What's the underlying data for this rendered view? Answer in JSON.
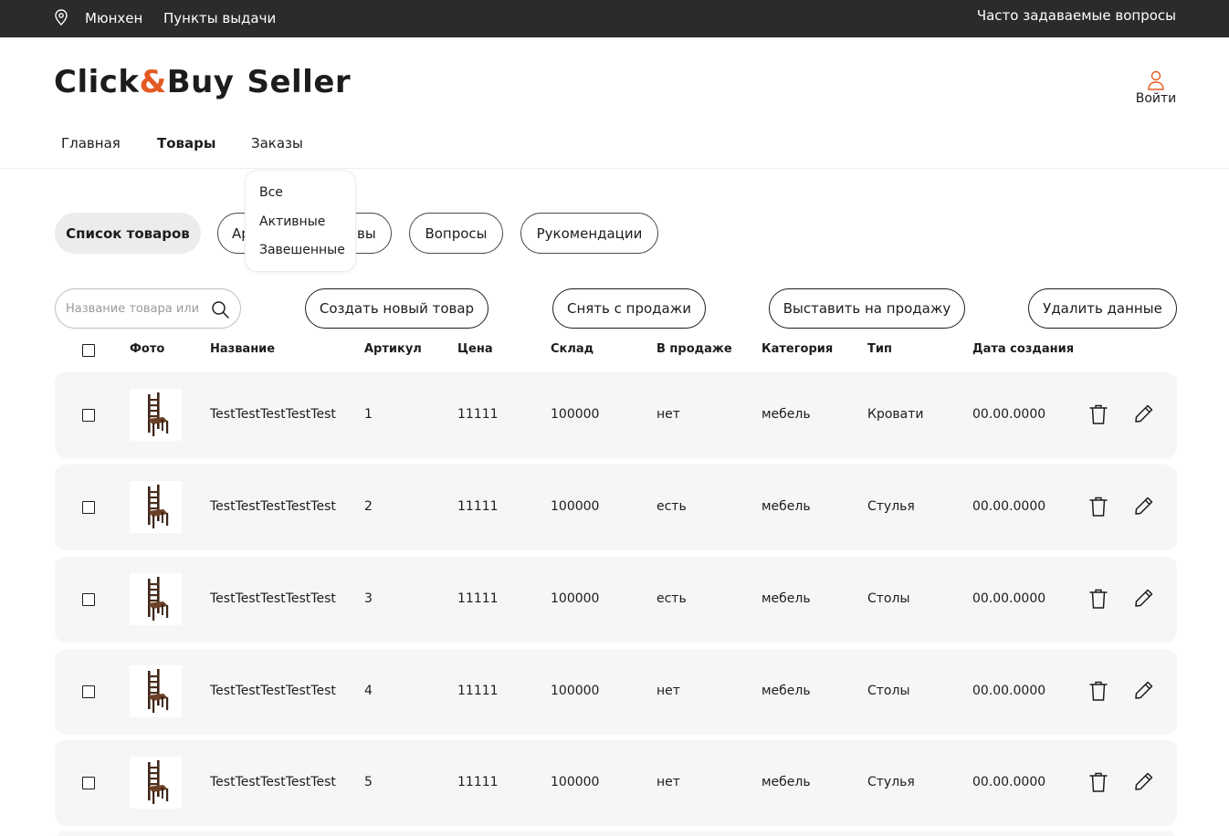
{
  "topbar": {
    "city": "Мюнхен",
    "pickup_points": "Пункты выдачи",
    "faq": "Часто задаваемые вопросы",
    "location_icon": "map-pin-icon"
  },
  "header": {
    "logo_left": "Click",
    "logo_amp": "&",
    "logo_right": "Buy",
    "logo_suffix": "Seller",
    "login_label": "Войти",
    "user_icon": "user-icon"
  },
  "colors": {
    "topbar_bg": "#2b2a2d",
    "accent": "#e35a22",
    "row_bg": "#f6f6f6",
    "active_tab_bg": "#ececec"
  },
  "nav": {
    "items": [
      {
        "label": "Главная"
      },
      {
        "label": "Товары",
        "active": true
      },
      {
        "label": "Заказы"
      }
    ]
  },
  "tabs": [
    {
      "label": "Список товаров",
      "active": true
    },
    {
      "label_visible_start": "Ар",
      "label_visible_end": "вы"
    },
    {
      "label": "Вопросы"
    },
    {
      "label": "Рукомендации"
    }
  ],
  "dropdown": {
    "items": [
      "Все",
      "Активные",
      "Завешенные"
    ]
  },
  "toolbar": {
    "search_placeholder": "Название товара или",
    "buttons": {
      "create": "Создать новый товар",
      "remove": "Снять с продажи",
      "publish": "Выставить на продажу",
      "delete": "Удалить данные"
    }
  },
  "table": {
    "columns": [
      "Фото",
      "Название",
      "Артикул",
      "Цена",
      "Склад",
      "В продаже",
      "Категория",
      "Тип",
      "Дата создания"
    ],
    "rows": [
      {
        "name": "TestTestTestTestTest",
        "sku": "1",
        "price": "11111",
        "stock": "100000",
        "on_sale": "нет",
        "category": "мебель",
        "type": "Кровати",
        "date": "00.00.0000"
      },
      {
        "name": "TestTestTestTestTest",
        "sku": "2",
        "price": "11111",
        "stock": "100000",
        "on_sale": "есть",
        "category": "мебель",
        "type": "Стулья",
        "date": "00.00.0000"
      },
      {
        "name": "TestTestTestTestTest",
        "sku": "3",
        "price": "11111",
        "stock": "100000",
        "on_sale": "есть",
        "category": "мебель",
        "type": "Столы",
        "date": "00.00.0000"
      },
      {
        "name": "TestTestTestTestTest",
        "sku": "4",
        "price": "11111",
        "stock": "100000",
        "on_sale": "нет",
        "category": "мебель",
        "type": "Столы",
        "date": "00.00.0000"
      },
      {
        "name": "TestTestTestTestTest",
        "sku": "5",
        "price": "11111",
        "stock": "100000",
        "on_sale": "нет",
        "category": "мебель",
        "type": "Стулья",
        "date": "00.00.0000"
      }
    ]
  }
}
